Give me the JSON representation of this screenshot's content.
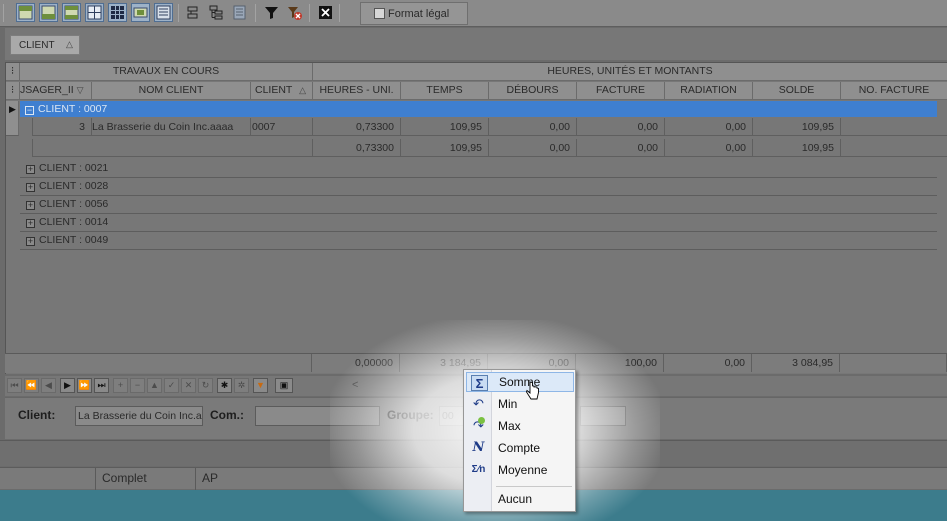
{
  "toolbar": {
    "format_legal_label": "Format légal",
    "icons": [
      "layout-top-icon",
      "layout-bottom-icon",
      "layout-both-icon",
      "grid-icon",
      "grid-dark-icon",
      "fit-width-icon",
      "list-view-icon",
      "tree-collapse-icon",
      "tree-expand-icon",
      "report-icon",
      "filter-icon",
      "filter-clear-icon",
      "close-icon"
    ]
  },
  "group_panel": {
    "chip_label": "CLIENT"
  },
  "grid": {
    "band1": {
      "left": "TRAVAUX EN COURS",
      "right": "HEURES, UNITÉS  ET MONTANTS"
    },
    "columns": [
      "JSAGER_II",
      "NOM CLIENT",
      "CLIENT",
      "HEURES - UNI.",
      "TEMPS",
      "DÉBOURS",
      "FACTURE",
      "RADIATION",
      "SOLDE",
      "NO. FACTURE"
    ],
    "selected_group": "CLIENT : 0007",
    "detail_row": [
      "3",
      "La Brasserie du Coin Inc.aaaa",
      "0007",
      "0,73300",
      "109,95",
      "0,00",
      "0,00",
      "0,00",
      "109,95",
      ""
    ],
    "group_total": [
      "0,73300",
      "109,95",
      "0,00",
      "0,00",
      "0,00",
      "109,95"
    ],
    "collapsed_groups": [
      "CLIENT : 0021",
      "CLIENT : 0028",
      "CLIENT : 0056",
      "CLIENT : 0014",
      "CLIENT : 0049"
    ],
    "grand_total": [
      "0,00000",
      "3 184,95",
      "0,00",
      "100,00",
      "0,00",
      "3 084,95"
    ]
  },
  "navigator": {
    "scroll_hint": "<"
  },
  "form": {
    "client_label": "Client:",
    "client_value": "La Brasserie du Coin Inc.a",
    "com_label": "Com.:",
    "com_value": "",
    "groupe_label": "Groupe:",
    "groupe_value": "00"
  },
  "status_bar": {
    "cells": [
      "",
      "Complet",
      "AP"
    ]
  },
  "context_menu": {
    "items": [
      {
        "label": "Somme",
        "icon": "sum-icon",
        "glyph": "Σ",
        "highlighted": true
      },
      {
        "label": "Min",
        "icon": "min-icon",
        "glyph": "↶",
        "highlighted": false
      },
      {
        "label": "Max",
        "icon": "max-icon",
        "glyph": "↷",
        "highlighted": false
      },
      {
        "label": "Compte",
        "icon": "count-icon",
        "glyph": "N",
        "highlighted": false
      },
      {
        "label": "Moyenne",
        "icon": "average-icon",
        "glyph": "Σ⁄n",
        "highlighted": false
      },
      {
        "label": "Aucun",
        "icon": "",
        "glyph": "",
        "highlighted": false
      }
    ]
  },
  "colors": {
    "selection": "#3f7fd0",
    "menu_highlight": "#dce9f8",
    "accent_teal": "#3c7c8c"
  }
}
